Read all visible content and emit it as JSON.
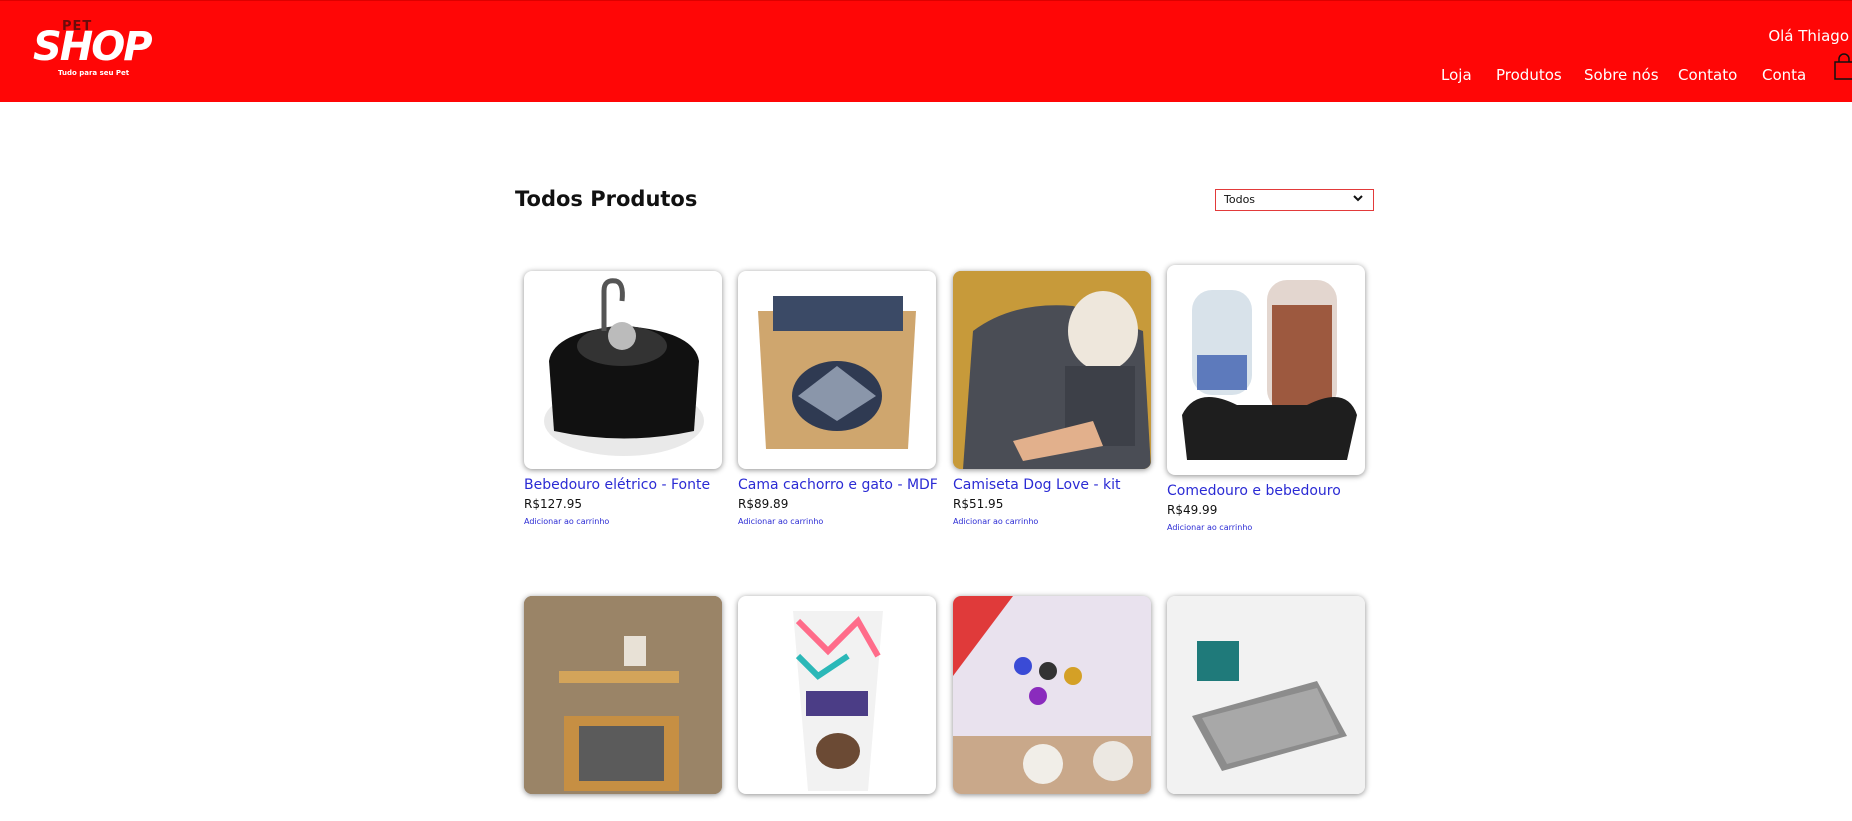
{
  "header": {
    "logo_pet": "PET",
    "logo_shop": "SHOP",
    "logo_tagline": "Tudo para seu Pet",
    "greeting": "Olá Thiago",
    "nav": [
      "Loja",
      "Produtos",
      "Sobre nós",
      "Contato",
      "Conta"
    ],
    "brand_color": "#ff0606"
  },
  "main": {
    "title": "Todos Produtos",
    "filter_value": "Todos"
  },
  "products": [
    {
      "name": "Bebedouro elétrico - Fonte",
      "price": "R$127.95",
      "add": "Adicionar ao carrinho"
    },
    {
      "name": "Cama cachorro e gato - MDF",
      "price": "R$89.89",
      "add": "Adicionar ao carrinho"
    },
    {
      "name": "Camiseta Dog Love - kit",
      "price": "R$51.95",
      "add": "Adicionar ao carrinho"
    },
    {
      "name": "Comedouro e bebedouro",
      "price": "R$49.99",
      "add": "Adicionar ao carrinho"
    }
  ]
}
